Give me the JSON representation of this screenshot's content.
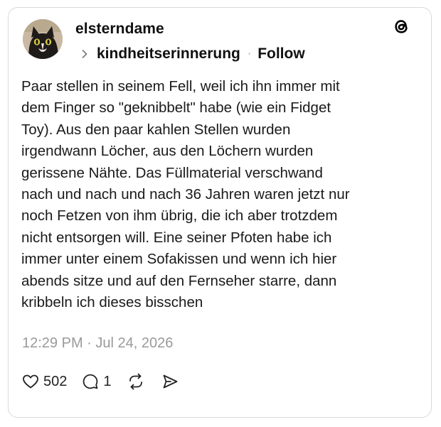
{
  "post": {
    "author": "elsterndame",
    "topic": "kindheitserinnerung",
    "separator": "·",
    "follow_label": "Follow",
    "body": "Paar stellen in seinem Fell, weil ich ihn immer mit\ndem Finger so \"geknibbelt\" habe (wie ein Fidget\nToy). Aus den paar kahlen Stellen wurden\nirgendwann Löcher, aus den Löchern wurden\ngerissene Nähte. Das Füllmaterial verschwand\nnach und nach und nach 36 Jahren waren jetzt nur\nnoch Fetzen von ihm übrig, die ich aber trotzdem\nnicht entsorgen will. Eine seiner Pfoten habe ich\nimmer unter einem Sofakissen und wenn ich hier\nabends sitze und auf den Fernseher starre, dann\nkribbeln ich dieses bisschen",
    "timestamp": "12:29 PM · Jul 24, 2026"
  },
  "actions": {
    "like_count": "502",
    "reply_count": "1"
  },
  "icons": {
    "logo": "threads-logo-icon",
    "chevron": "chevron-right-icon",
    "like": "heart-icon",
    "reply": "comment-icon",
    "repost": "repost-icon",
    "share": "send-icon"
  },
  "colors": {
    "text": "#111111",
    "muted": "#9a9a9a",
    "border": "#d9d9d9",
    "background": "#ffffff"
  }
}
